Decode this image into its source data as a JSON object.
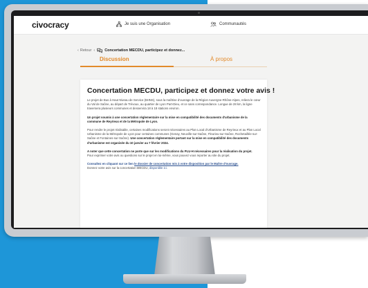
{
  "app": {
    "logo": "civocracy",
    "nav": [
      {
        "label": "Je suis une Organisation",
        "icon": "organization-icon"
      },
      {
        "label": "Communautés",
        "icon": "communities-icon"
      }
    ]
  },
  "breadcrumb": {
    "back_label": "Retour",
    "separator": "‹",
    "page_title": "Concertation MECDU, participez et donnez..."
  },
  "tabs": [
    {
      "label": "Discussion",
      "active": true
    },
    {
      "label": "À propos",
      "active": false
    }
  ],
  "article": {
    "title": "Concertation MECDU, participez et donnez votre avis !",
    "p1": "Le projet de Bus à Haut Niveau de Service (BHNS), sous la maîtrise d'ouvrage de la Région Auvergne-Rhône-Alpes, reliera le cœur du Val de Saône, au départ de Trévoux, au quartier de Lyon Part-Dieu, et ce sans correspondance. Longue de 28 km, la ligne traversera plusieurs communes et desservira 18 à 18 stations environ.",
    "p2": "Un projet soumis à une concertation réglementaire sur la mise en compatibilité des documents d'urbanisme de la commune de Reyrieux et de la Métropole de Lyon.",
    "p3": "Pour rendre le projet réalisable, certaines modifications seront nécessaires au Plan Local d'Urbanisme de Reyrieux et au Plan Local Urbanisme de la Métropole de Lyon pour certaines communes (Genay, Neuville-sur-Saône, Fleurieu-sur-Saône, Rochetaillée-sur-Saône et Fontaines-sur-Saône).",
    "p3_bold": "Une concertation réglementaire portant sur la mise en compatibilité des documents d'urbanisme est organisée du 10 janvier au 7 février 2024.",
    "p4_bold": "A noter que cette concertation ne porte que sur les modifications du PLU-H nécessaires pour la réalisation du projet.",
    "p4": "Pour exprimer votre avis ou questions sur le projet en lui-même, vous pouvez vous reporter au site du projet.",
    "p5_prefix": "Consultez en cliquant sur ce lien",
    "p5_link": "le dossier de concertation mis à votre disposition par le Maître d'ouvrage.",
    "p6_prefix": "Donnez votre avis sur la concertation MECDU,",
    "p6_link": "disponible ici."
  },
  "colors": {
    "accent": "#e28a2a",
    "background_blue": "#1e96d8",
    "link": "#2a4f8f"
  }
}
